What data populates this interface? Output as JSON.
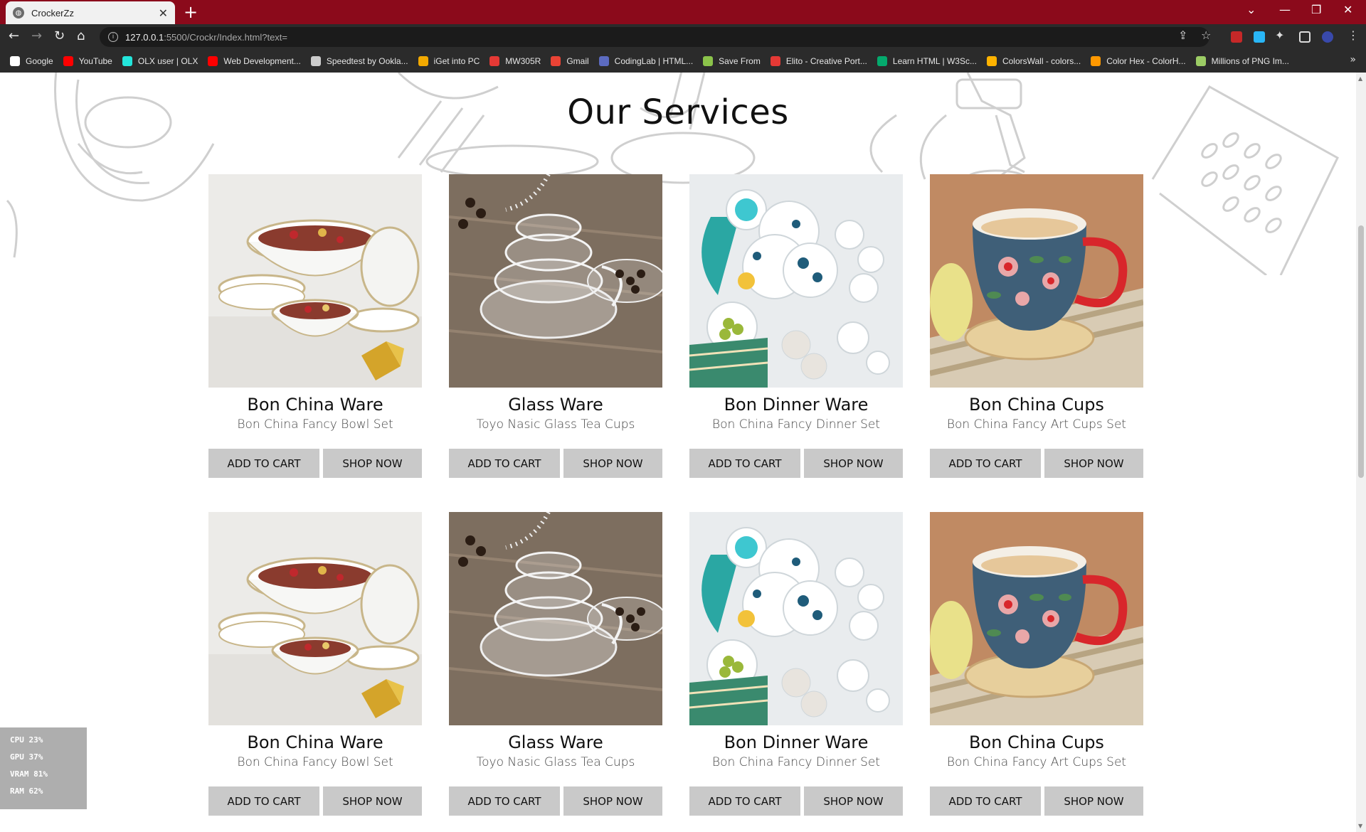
{
  "browser": {
    "tab_title": "CrockerZz",
    "url_host": "127.0.0.1",
    "url_path": ":5500/Crockr/Index.html?text=",
    "bookmarks": [
      {
        "label": "Google",
        "color": "#ffffff"
      },
      {
        "label": "YouTube",
        "color": "#ff0000"
      },
      {
        "label": "OLX user | OLX",
        "color": "#23e5db"
      },
      {
        "label": "Web Development...",
        "color": "#ff0000"
      },
      {
        "label": "Speedtest by Ookla...",
        "color": "#cccccc"
      },
      {
        "label": "iGet into PC",
        "color": "#f2a900"
      },
      {
        "label": "MW305R",
        "color": "#e53935"
      },
      {
        "label": "Gmail",
        "color": "#ea4335"
      },
      {
        "label": "CodingLab | HTML...",
        "color": "#5c6bc0"
      },
      {
        "label": "Save From",
        "color": "#8bc34a"
      },
      {
        "label": "Elito - Creative Port...",
        "color": "#e53935"
      },
      {
        "label": "Learn HTML | W3Sc...",
        "color": "#04aa6d"
      },
      {
        "label": "ColorsWall - colors...",
        "color": "#ffb300"
      },
      {
        "label": "Color Hex - ColorH...",
        "color": "#ff9800"
      },
      {
        "label": "Millions of PNG Im...",
        "color": "#9ccc65"
      }
    ]
  },
  "page": {
    "section_title": "Our Services",
    "products": [
      {
        "name": "Bon China Ware",
        "desc": "Bon China Fancy Bowl Set",
        "add": "ADD TO CART",
        "shop": "SHOP NOW",
        "image": "bowl-set"
      },
      {
        "name": "Glass Ware",
        "desc": "Toyo Nasic Glass Tea Cups",
        "add": "ADD TO CART",
        "shop": "SHOP NOW",
        "image": "glass-cups"
      },
      {
        "name": "Bon Dinner Ware",
        "desc": "Bon China Fancy Dinner Set",
        "add": "ADD TO CART",
        "shop": "SHOP NOW",
        "image": "dinner-set"
      },
      {
        "name": "Bon China Cups",
        "desc": "Bon China Fancy Art Cups Set",
        "add": "ADD TO CART",
        "shop": "SHOP NOW",
        "image": "art-cup"
      },
      {
        "name": "Bon China Ware",
        "desc": "Bon China Fancy Bowl Set",
        "add": "ADD TO CART",
        "shop": "SHOP NOW",
        "image": "bowl-set"
      },
      {
        "name": "Glass Ware",
        "desc": "Toyo Nasic Glass Tea Cups",
        "add": "ADD TO CART",
        "shop": "SHOP NOW",
        "image": "glass-cups"
      },
      {
        "name": "Bon Dinner Ware",
        "desc": "Bon China Fancy Dinner Set",
        "add": "ADD TO CART",
        "shop": "SHOP NOW",
        "image": "dinner-set"
      },
      {
        "name": "Bon China Cups",
        "desc": "Bon China Fancy Art Cups Set",
        "add": "ADD TO CART",
        "shop": "SHOP NOW",
        "image": "art-cup"
      }
    ]
  },
  "overlay": {
    "cpu": "CPU  23%",
    "gpu": "GPU  37%",
    "vram": "VRAM  81%",
    "ram": "RAM  62%"
  },
  "colors": {
    "tabbar": "#8b0a1b",
    "toolbar": "#2b2b2b",
    "button_bg": "#c9c9c9"
  }
}
